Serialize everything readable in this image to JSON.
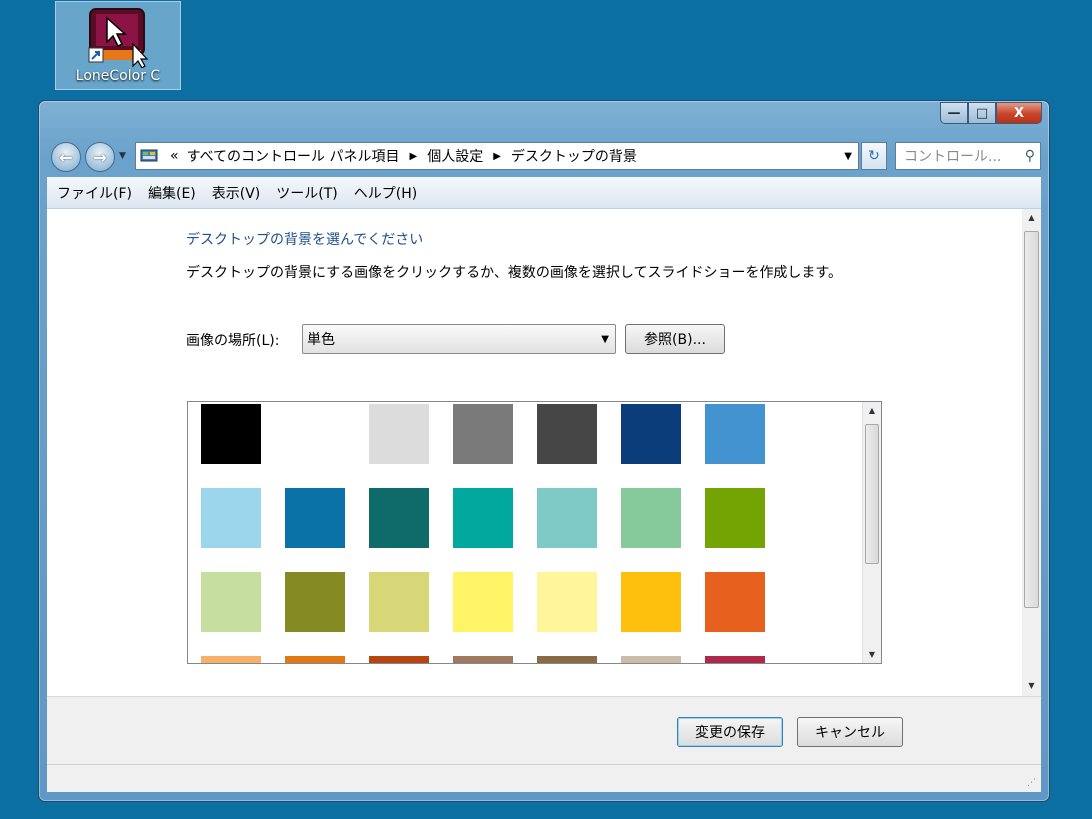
{
  "desktop": {
    "icon_label": "LoneColor C"
  },
  "window": {
    "controls": {
      "minimize": "—",
      "maximize": "□",
      "close": "X"
    },
    "nav": {
      "back": "←",
      "forward": "→",
      "breadcrumb_prefix": "«",
      "breadcrumbs": [
        "すべてのコントロール パネル項目",
        "個人設定",
        "デスクトップの背景"
      ],
      "search_placeholder": "コントロール..."
    },
    "menu": [
      "ファイル(F)",
      "編集(E)",
      "表示(V)",
      "ツール(T)",
      "ヘルプ(H)"
    ],
    "content": {
      "title": "デスクトップの背景を選んでください",
      "description": "デスクトップの背景にする画像をクリックするか、複数の画像を選択してスライドショーを作成します。",
      "location_label": "画像の場所(L):",
      "location_value": "単色",
      "browse_label": "参照(B)...",
      "swatches": [
        "#000000",
        "#ffffff",
        "#dcdcdc",
        "#7a7a7a",
        "#464646",
        "#0b3d7a",
        "#4393d0",
        "#9cd6ec",
        "#0b72a8",
        "#0f6a6a",
        "#00a89d",
        "#7ecac7",
        "#86c99a",
        "#74a404",
        "#c6df9f",
        "#858a22",
        "#d8d777",
        "#fff366",
        "#fff59a",
        "#ffc00d",
        "#e8601e",
        "#f6b06a",
        "#e07914",
        "#b7450d",
        "#a1785e",
        "#8a6b46",
        "#c9bca9",
        "#b02849"
      ]
    },
    "footer": {
      "save_label": "変更の保存",
      "cancel_label": "キャンセル"
    }
  },
  "colors": {
    "desktop_bg": "#0b6fa2",
    "link_title": "#1e4e8c"
  }
}
